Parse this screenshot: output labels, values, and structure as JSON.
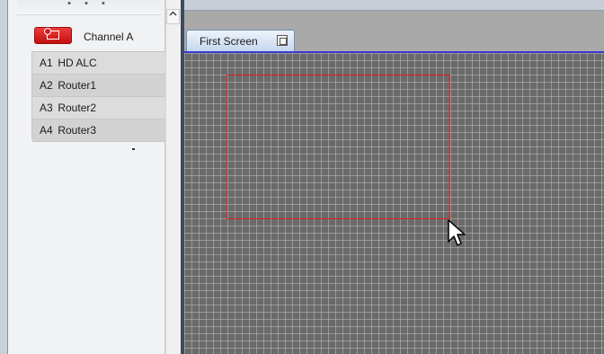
{
  "panel": {
    "grip": "• • •",
    "channel_label": "Channel A",
    "sources": [
      {
        "num": "A1",
        "name": "HD ALC"
      },
      {
        "num": "A2",
        "name": "Router1"
      },
      {
        "num": "A3",
        "name": "Router2"
      },
      {
        "num": "A4",
        "name": "Router3"
      }
    ]
  },
  "tabs": [
    {
      "label": "First Screen"
    }
  ],
  "colors": {
    "channel_icon": "#d41e1e",
    "canvas_bg": "#6a6a6a",
    "selection_border": "#e02020"
  },
  "icons": {
    "channel": "channel-icon",
    "tab": "restore-icon",
    "scroll_up": "chevron-up-icon",
    "cursor": "mouse-pointer-icon"
  }
}
